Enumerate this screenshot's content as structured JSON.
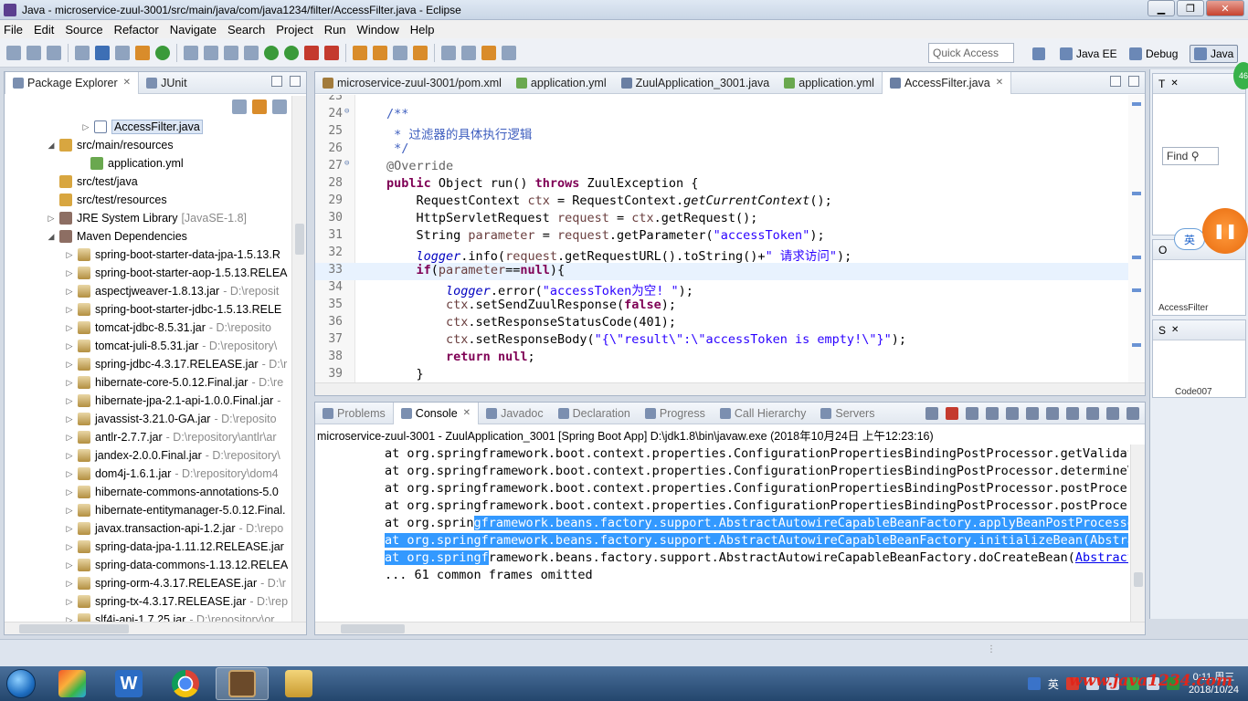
{
  "window": {
    "title": "Java - microservice-zuul-3001/src/main/java/com/java1234/filter/AccessFilter.java - Eclipse",
    "minimize_label": "▁",
    "maximize_label": "❐",
    "close_label": "✕"
  },
  "menu": [
    "File",
    "Edit",
    "Source",
    "Refactor",
    "Navigate",
    "Search",
    "Project",
    "Run",
    "Window",
    "Help"
  ],
  "toolbar": {
    "quick_access_placeholder": "Quick Access",
    "perspectives": [
      "Java EE",
      "Debug",
      "Java"
    ]
  },
  "package_explorer": {
    "tabs": [
      {
        "label": "Package Explorer"
      },
      {
        "label": "JUnit"
      }
    ],
    "tree": [
      {
        "label": "AccessFilter.java",
        "path": "",
        "icon": "java-file-icon",
        "expand": "▷",
        "level": 3,
        "selected": true
      },
      {
        "label": "src/main/resources",
        "path": "",
        "icon": "source-folder-icon",
        "expand": "◢",
        "level": 2
      },
      {
        "label": "application.yml",
        "path": "",
        "icon": "yml-file-icon",
        "expand": "",
        "level": 3
      },
      {
        "label": "src/test/java",
        "path": "",
        "icon": "source-folder-icon",
        "expand": "",
        "level": 2
      },
      {
        "label": "src/test/resources",
        "path": "",
        "icon": "source-folder-icon",
        "expand": "",
        "level": 2
      },
      {
        "label": "JRE System Library",
        "path": "[JavaSE-1.8]",
        "icon": "library-icon",
        "expand": "▷",
        "level": 2
      },
      {
        "label": "Maven Dependencies",
        "path": "",
        "icon": "library-icon",
        "expand": "◢",
        "level": 2
      },
      {
        "label": "spring-boot-starter-data-jpa-1.5.13.R",
        "path": "",
        "icon": "jar-icon",
        "expand": "▷",
        "level": 3
      },
      {
        "label": "spring-boot-starter-aop-1.5.13.RELEA",
        "path": "",
        "icon": "jar-icon",
        "expand": "▷",
        "level": 3
      },
      {
        "label": "aspectjweaver-1.8.13.jar",
        "path": "- D:\\reposit",
        "icon": "jar-icon",
        "expand": "▷",
        "level": 3
      },
      {
        "label": "spring-boot-starter-jdbc-1.5.13.RELE",
        "path": "",
        "icon": "jar-icon",
        "expand": "▷",
        "level": 3
      },
      {
        "label": "tomcat-jdbc-8.5.31.jar",
        "path": "- D:\\reposito",
        "icon": "jar-icon",
        "expand": "▷",
        "level": 3
      },
      {
        "label": "tomcat-juli-8.5.31.jar",
        "path": "- D:\\repository\\",
        "icon": "jar-icon",
        "expand": "▷",
        "level": 3
      },
      {
        "label": "spring-jdbc-4.3.17.RELEASE.jar",
        "path": "- D:\\r",
        "icon": "jar-icon",
        "expand": "▷",
        "level": 3
      },
      {
        "label": "hibernate-core-5.0.12.Final.jar",
        "path": "- D:\\re",
        "icon": "jar-icon",
        "expand": "▷",
        "level": 3
      },
      {
        "label": "hibernate-jpa-2.1-api-1.0.0.Final.jar",
        "path": "-",
        "icon": "jar-icon",
        "expand": "▷",
        "level": 3
      },
      {
        "label": "javassist-3.21.0-GA.jar",
        "path": "- D:\\reposito",
        "icon": "jar-icon",
        "expand": "▷",
        "level": 3
      },
      {
        "label": "antlr-2.7.7.jar",
        "path": "- D:\\repository\\antlr\\ar",
        "icon": "jar-icon",
        "expand": "▷",
        "level": 3
      },
      {
        "label": "jandex-2.0.0.Final.jar",
        "path": "- D:\\repository\\",
        "icon": "jar-icon",
        "expand": "▷",
        "level": 3
      },
      {
        "label": "dom4j-1.6.1.jar",
        "path": "- D:\\repository\\dom4",
        "icon": "jar-icon",
        "expand": "▷",
        "level": 3
      },
      {
        "label": "hibernate-commons-annotations-5.0",
        "path": "",
        "icon": "jar-icon",
        "expand": "▷",
        "level": 3
      },
      {
        "label": "hibernate-entitymanager-5.0.12.Final.",
        "path": "",
        "icon": "jar-icon",
        "expand": "▷",
        "level": 3
      },
      {
        "label": "javax.transaction-api-1.2.jar",
        "path": "- D:\\repo",
        "icon": "jar-icon",
        "expand": "▷",
        "level": 3
      },
      {
        "label": "spring-data-jpa-1.11.12.RELEASE.jar",
        "path": "",
        "icon": "jar-icon",
        "expand": "▷",
        "level": 3
      },
      {
        "label": "spring-data-commons-1.13.12.RELEA",
        "path": "",
        "icon": "jar-icon",
        "expand": "▷",
        "level": 3
      },
      {
        "label": "spring-orm-4.3.17.RELEASE.jar",
        "path": "- D:\\r",
        "icon": "jar-icon",
        "expand": "▷",
        "level": 3
      },
      {
        "label": "spring-tx-4.3.17.RELEASE.jar",
        "path": "- D:\\rep",
        "icon": "jar-icon",
        "expand": "▷",
        "level": 3
      },
      {
        "label": "slf4j-api-1.7.25.jar",
        "path": "- D:\\repository\\or",
        "icon": "jar-icon",
        "expand": "▷",
        "level": 3
      }
    ]
  },
  "editor": {
    "tabs": [
      {
        "label": "microservice-zuul-3001/pom.xml",
        "active": false
      },
      {
        "label": "application.yml",
        "active": false
      },
      {
        "label": "ZuulApplication_3001.java",
        "active": false
      },
      {
        "label": "application.yml",
        "active": false
      },
      {
        "label": "AccessFilter.java",
        "active": true
      }
    ],
    "lines": [
      {
        "n": "23",
        "fold": "",
        "html": ""
      },
      {
        "n": "24",
        "fold": "⊖",
        "html": "<span class='cm'>/**</span>"
      },
      {
        "n": "25",
        "fold": "",
        "html": "<span class='cm'> * 过滤器的具体执行逻辑</span>"
      },
      {
        "n": "26",
        "fold": "",
        "html": "<span class='cm'> */</span>"
      },
      {
        "n": "27",
        "fold": "⊖",
        "html": "<span class='ann'>@Override</span>"
      },
      {
        "n": "28",
        "fold": "",
        "html": "<span class='kw'>public</span> Object run() <span class='kw'>throws</span> ZuulException {"
      },
      {
        "n": "29",
        "fold": "",
        "html": "    RequestContext <span class='var'>ctx</span> = RequestContext.<span class='it'>getCurrentContext</span>();"
      },
      {
        "n": "30",
        "fold": "",
        "html": "    HttpServletRequest <span class='var'>request</span> = <span class='var'>ctx</span>.getRequest();"
      },
      {
        "n": "31",
        "fold": "",
        "html": "    String <span class='var'>parameter</span> = <span class='var'>request</span>.getParameter(<span class='str'>\"accessToken\"</span>);"
      },
      {
        "n": "32",
        "fold": "",
        "html": "    <span class='fld it'>logger</span>.info(<span class='var'>request</span>.getRequestURL().toString()+<span class='str'>\" 请求访问\"</span>);"
      },
      {
        "n": "33",
        "fold": "",
        "html": "    <span class='kw'>if</span>(<span class='var'>parameter</span>==<span class='kw'>null</span>){"
      },
      {
        "n": "34",
        "fold": "",
        "html": "        <span class='fld it'>logger</span>.error(<span class='str'>\"accessToken为空! \"</span>);"
      },
      {
        "n": "35",
        "fold": "",
        "html": "        <span class='var'>ctx</span>.setSendZuulResponse(<span class='kw'>false</span>);"
      },
      {
        "n": "36",
        "fold": "",
        "html": "        <span class='var'>ctx</span>.setResponseStatusCode(401);"
      },
      {
        "n": "37",
        "fold": "",
        "html": "        <span class='var'>ctx</span>.setResponseBody(<span class='str'>\"{\\\"result\\\":\\\"accessToken is empty!\\\"}\"</span>);"
      },
      {
        "n": "38",
        "fold": "",
        "html": "        <span class='kw'>return</span> <span class='kw'>null</span>;"
      },
      {
        "n": "39",
        "fold": "",
        "html": "    }"
      }
    ]
  },
  "bottom": {
    "tabs": [
      "Problems",
      "Console",
      "Javadoc",
      "Declaration",
      "Progress",
      "Call Hierarchy",
      "Servers"
    ],
    "active_tab": "Console",
    "launch_info": "microservice-zuul-3001 - ZuulApplication_3001 [Spring Boot App] D:\\jdk1.8\\bin\\javaw.exe (2018年10月24日 上午12:23:16)",
    "lines": [
      {
        "html": "at org.springframework.boot.context.properties.ConfigurationPropertiesBindingPostProcessor.getValidator"
      },
      {
        "html": "at org.springframework.boot.context.properties.ConfigurationPropertiesBindingPostProcessor.determineVal"
      },
      {
        "html": "at org.springframework.boot.context.properties.ConfigurationPropertiesBindingPostProcessor.postProcessE"
      },
      {
        "html": "at org.springframework.boot.context.properties.ConfigurationPropertiesBindingPostProcessor.postProcessE"
      },
      {
        "html": "at org.sprin<span class='hl'>gframework.beans.factory.support.AbstractAutowireCapableBeanFactory.applyBeanPostProcessors</span>"
      },
      {
        "html": "<span class='hl'>at org.springframework.beans.factory.support.AbstractAutowireCapableBeanFactory.initializeBean(Abstract</span>"
      },
      {
        "html": "<span class='hl'>at org.springf</span>ramework.beans.factory.support.AbstractAutowireCapableBeanFactory.doCreateBean(<span class='link'>AbstractAu</span>"
      },
      {
        "html": "... 61 common frames omitted"
      }
    ]
  },
  "right_panels": {
    "top_label": "T",
    "find_placeholder": "Find",
    "mid_label": "O",
    "mid_item": "AccessFilter",
    "bottom_label": "S",
    "bottom_item": "Code007"
  },
  "overlay": {
    "ime_badge": "英",
    "record_label": "❚❚",
    "green_badge": "46"
  },
  "taskbar": {
    "apps": [
      "start-orb",
      "app-colorful",
      "app-word",
      "app-chrome",
      "app-eclipse",
      "app-explorer"
    ],
    "tray_ime": "英",
    "clock_time": "0:11 周三",
    "clock_date": "2018/10/24",
    "watermark": "www.java1234.com"
  }
}
